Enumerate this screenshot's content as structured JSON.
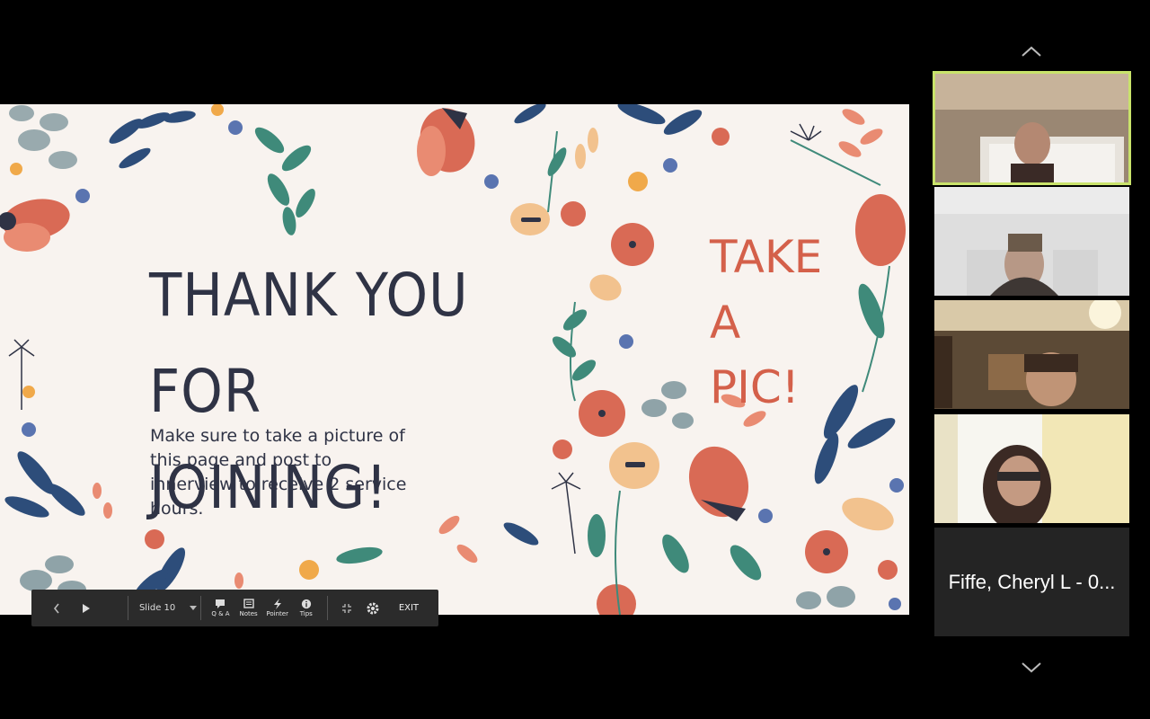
{
  "slide": {
    "title": "THANK YOU FOR JOINING!",
    "subtitle": "TAKE A PIC!",
    "body": "Make sure to take a picture of this page and post to innerview to receive 2 service hours."
  },
  "toolbar": {
    "slide_select": "Slide 10",
    "qa_label": "Q & A",
    "notes_label": "Notes",
    "pointer_label": "Pointer",
    "tips_label": "Tips",
    "exit_label": "EXIT"
  },
  "participants": {
    "name_tile": "Fiffe, Cheryl L - 0..."
  },
  "colors": {
    "active_speaker_border": "#c9e36b",
    "title_text": "#2f3345",
    "accent_text": "#d4604a",
    "slide_bg": "#f8f3ef"
  }
}
